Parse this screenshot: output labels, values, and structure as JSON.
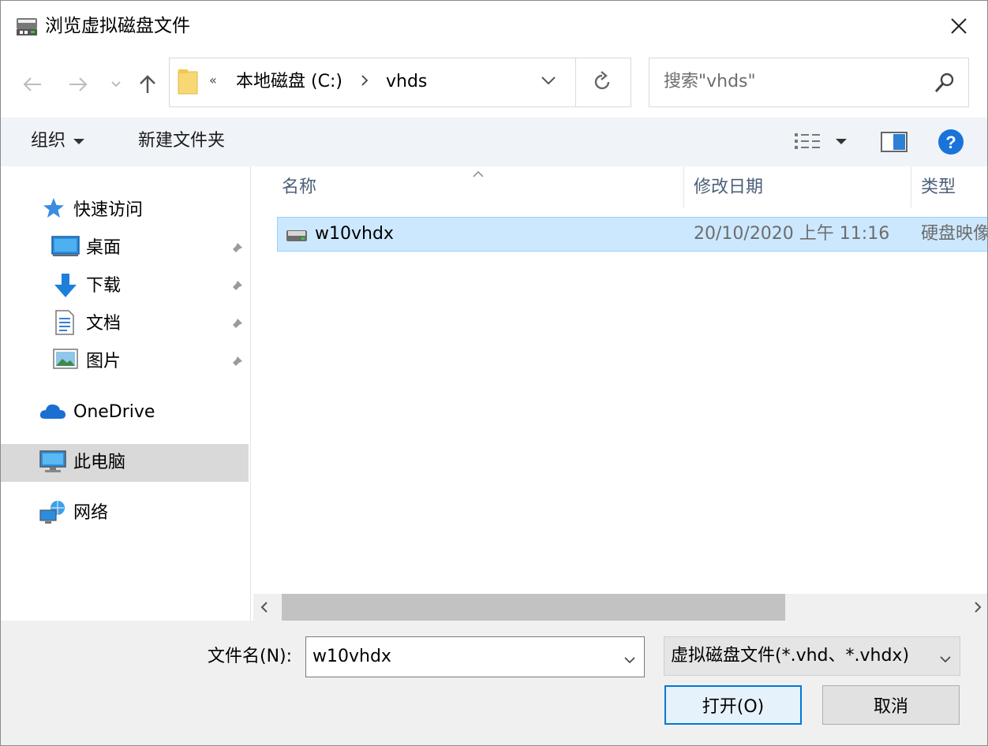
{
  "window": {
    "title": "浏览虚拟磁盘文件"
  },
  "address": {
    "overflow_chevron": "«",
    "segments": [
      "本地磁盘 (C:)",
      "vhds"
    ]
  },
  "search": {
    "placeholder": "搜索\"vhds\""
  },
  "toolbar": {
    "organize_label": "组织",
    "new_folder_label": "新建文件夹"
  },
  "navigation": {
    "quick_access": "快速访问",
    "quick_items": [
      {
        "label": "桌面",
        "icon": "desktop-icon"
      },
      {
        "label": "下载",
        "icon": "download-icon"
      },
      {
        "label": "文档",
        "icon": "documents-icon"
      },
      {
        "label": "图片",
        "icon": "pictures-icon"
      }
    ],
    "onedrive": "OneDrive",
    "this_pc": "此电脑",
    "network": "网络"
  },
  "columns": {
    "name": "名称",
    "modified": "修改日期",
    "type": "类型"
  },
  "files": [
    {
      "name": "w10vhdx",
      "modified": "20/10/2020 上午 11:16",
      "type": "硬盘映像文件",
      "icon": "drive-icon",
      "selected": true
    }
  ],
  "footer": {
    "filename_label": "文件名(N):",
    "filename_value": "w10vhdx",
    "filetype_value": "虚拟磁盘文件(*.vhd、*.vhdx)",
    "open_label": "打开(O)",
    "cancel_label": "取消"
  },
  "colors": {
    "accent": "#0078d7",
    "selection": "#cce8ff",
    "command_bar": "#f0f4f9"
  }
}
